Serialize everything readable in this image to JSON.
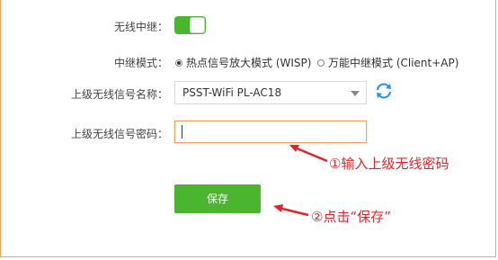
{
  "form": {
    "relay_label": "无线中继：",
    "relay_enabled": true,
    "mode_label": "中继模式：",
    "modes": [
      {
        "label": "热点信号放大模式 (WISP)",
        "selected": true
      },
      {
        "label": "万能中继模式 (Client+AP)",
        "selected": false
      }
    ],
    "ssid_label": "上级无线信号名称：",
    "ssid_value": "PSST-WiFi PL-AC18",
    "password_label": "上级无线信号密码：",
    "password_value": "",
    "save_label": "保存"
  },
  "annotations": {
    "step1": "①输入上级无线密码",
    "step2": "②点击“保存”"
  },
  "colors": {
    "accent_green": "#4cb52f",
    "annotation_red": "#e0252b",
    "frame_orange": "#f5a04a",
    "refresh_blue": "#2a8fe0"
  },
  "icons": {
    "refresh": "refresh-icon",
    "dropdown": "chevron-down-icon"
  }
}
